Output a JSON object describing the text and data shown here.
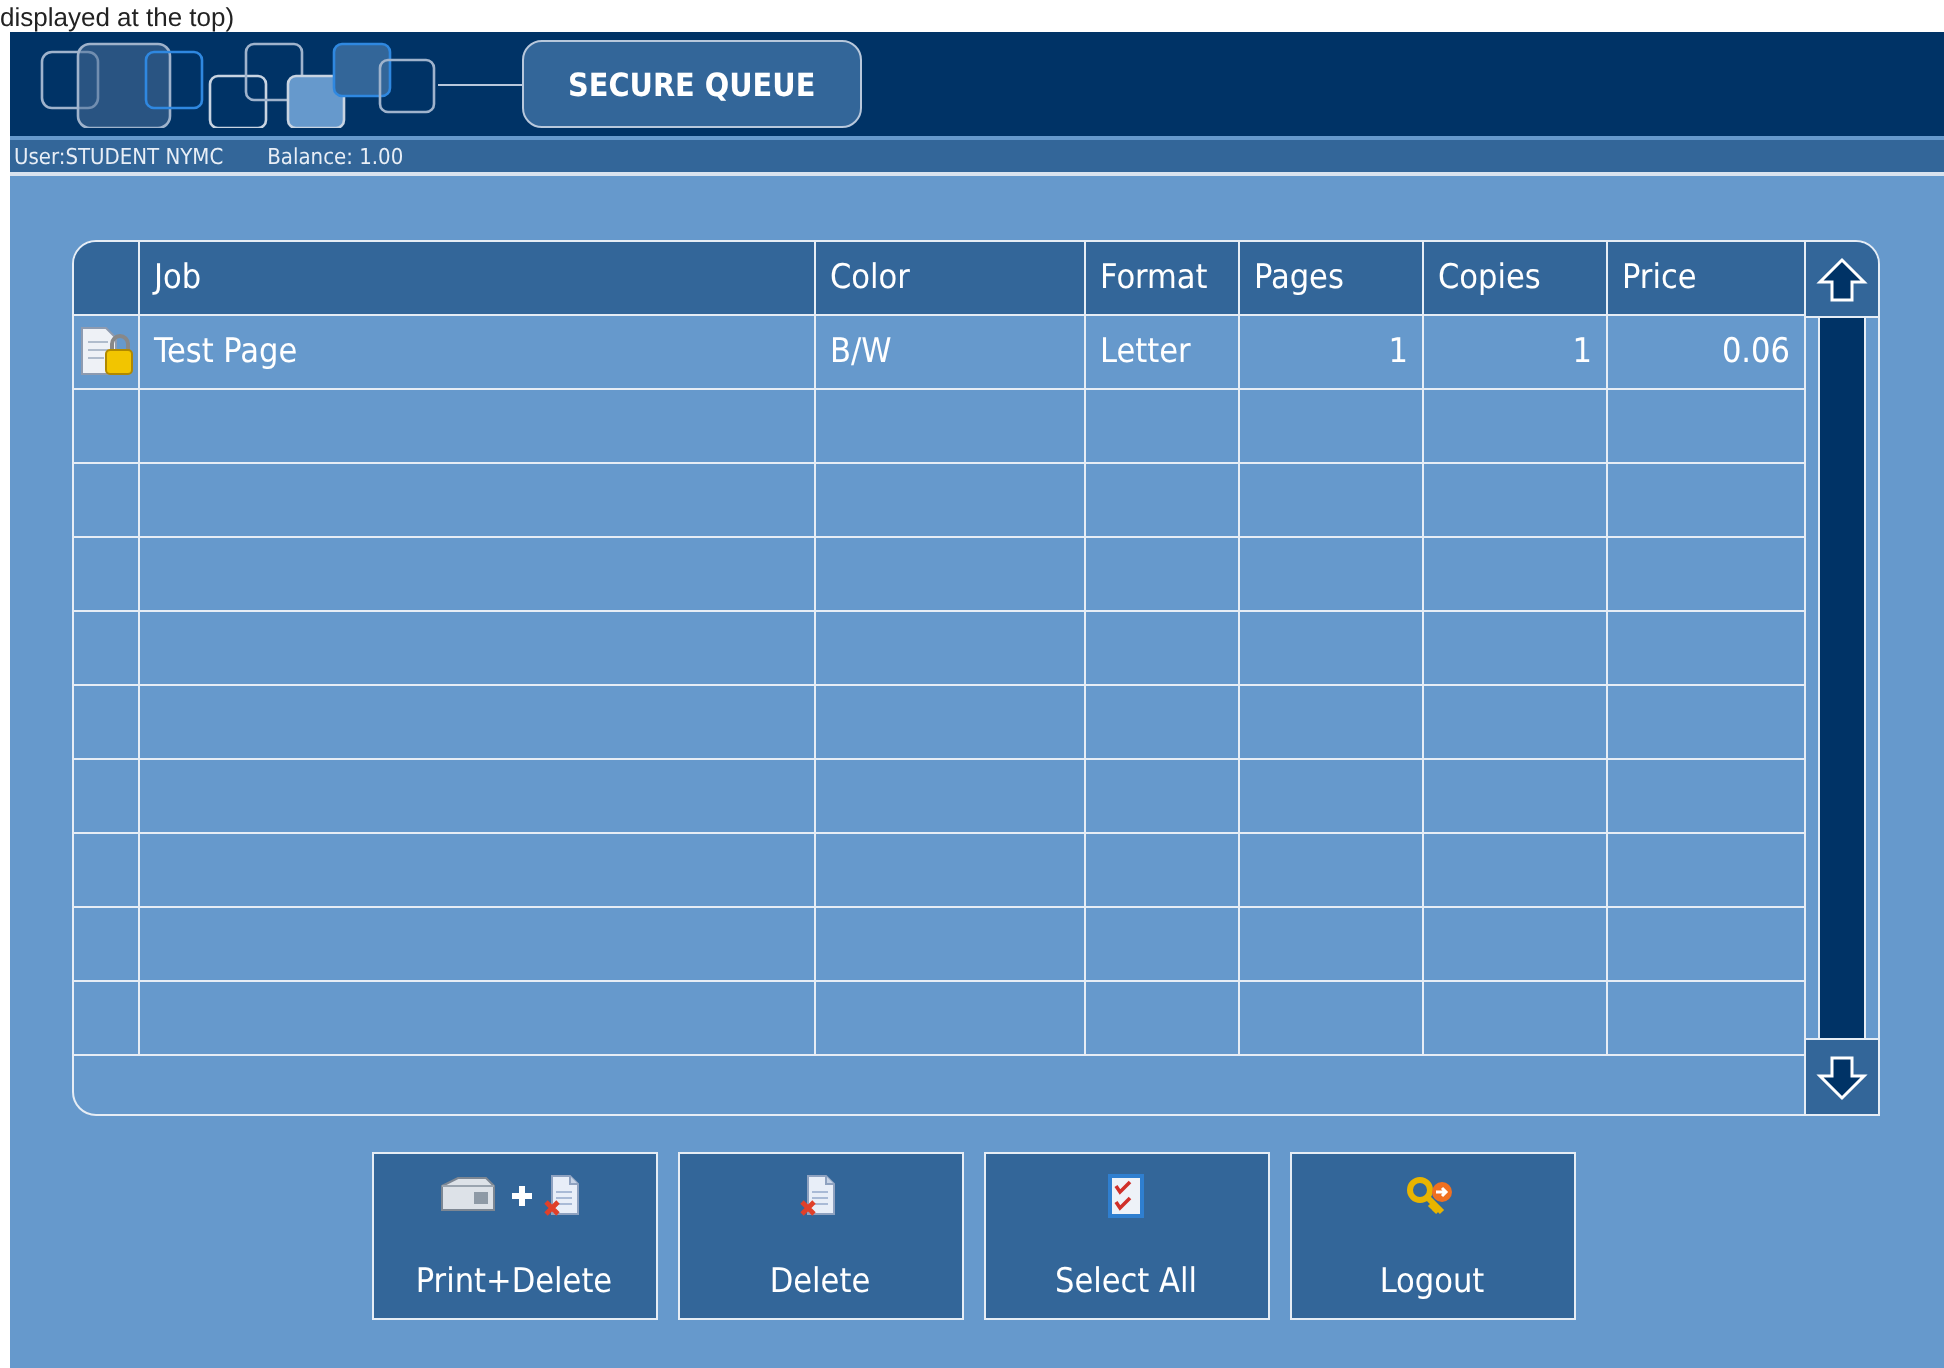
{
  "caption": "displayed at the top)",
  "header": {
    "title": "SECURE QUEUE"
  },
  "user_bar": {
    "user": "User:STUDENT NYMC",
    "balance": "Balance: 1.00"
  },
  "table": {
    "columns": [
      "Job",
      "Color",
      "Format",
      "Pages",
      "Copies",
      "Price"
    ],
    "rows": [
      {
        "locked": true,
        "cells": [
          "Test Page",
          "B/W",
          "Letter",
          "1",
          "1",
          "0.06"
        ]
      }
    ]
  },
  "buttons": [
    {
      "kind": "print-delete",
      "label": "Print+Delete"
    },
    {
      "kind": "delete",
      "label": "Delete"
    },
    {
      "kind": "select-all",
      "label": "Select All"
    },
    {
      "kind": "logout",
      "label": "Logout"
    }
  ]
}
